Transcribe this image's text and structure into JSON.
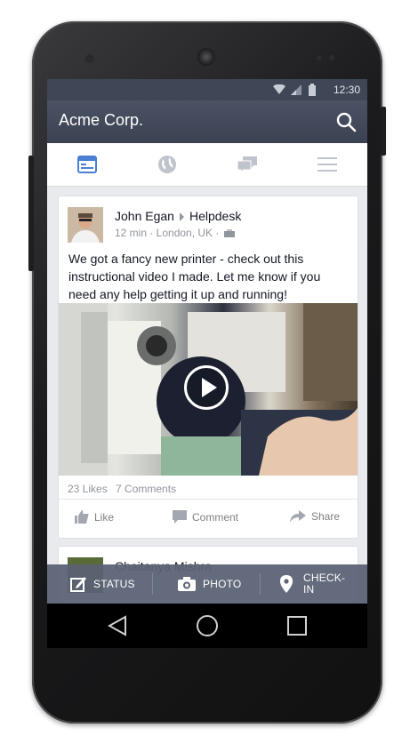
{
  "status_bar": {
    "time": "12:30"
  },
  "app_bar": {
    "title": "Acme Corp."
  },
  "tabs": [
    {
      "name": "news-feed",
      "icon": "news-feed-icon",
      "active": true
    },
    {
      "name": "globe",
      "icon": "globe-icon",
      "active": false
    },
    {
      "name": "messages",
      "icon": "chat-bubbles-icon",
      "active": false
    },
    {
      "name": "menu",
      "icon": "menu-icon",
      "active": false
    }
  ],
  "post": {
    "author": "John Egan",
    "group": "Helpdesk",
    "meta": "12 min · London, UK ·",
    "text": "We got a fancy new printer - check out this instructional video I made. Let me know if you need any help getting it up and running!",
    "likes": "23 Likes",
    "comments": "7 Comments",
    "actions": {
      "like": "Like",
      "comment": "Comment",
      "share": "Share"
    }
  },
  "next_post": {
    "author": "Chaitanya Mishra"
  },
  "bottom_bar": {
    "status": "STATUS",
    "photo": "PHOTO",
    "checkin_line1": "CHECK-",
    "checkin_line2": "IN"
  },
  "colors": {
    "accent": "#4a7fd4",
    "app_bar": "#3f4656",
    "bottom_bar": "#5a6274",
    "icon_gray": "#bfc3cb"
  }
}
